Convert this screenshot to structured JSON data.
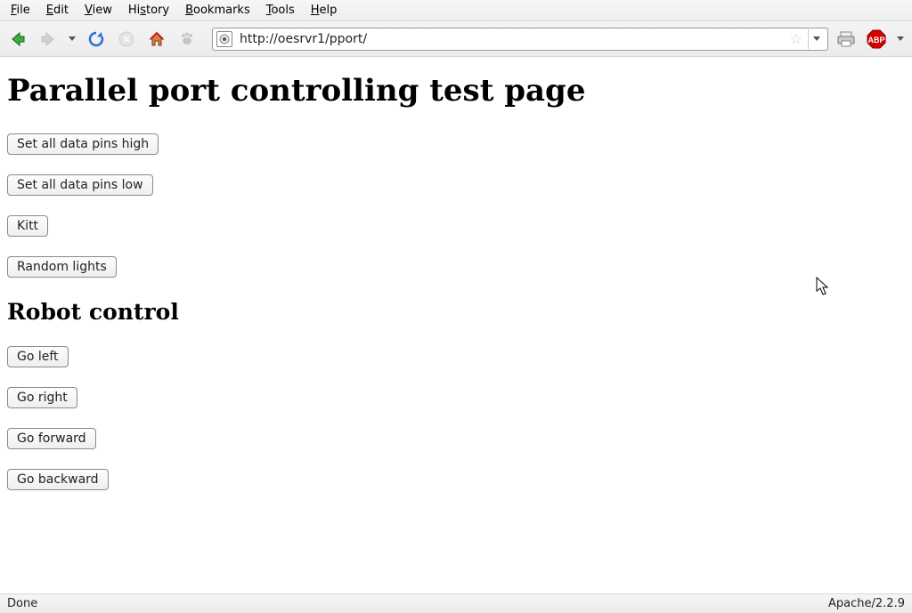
{
  "menubar": {
    "file": {
      "prefix": "F",
      "rest": "ile"
    },
    "edit": {
      "prefix": "E",
      "rest": "dit"
    },
    "view": {
      "prefix": "V",
      "rest": "iew"
    },
    "history": {
      "prefix": "Hi",
      "rest": "story"
    },
    "bookmarks": {
      "prefix": "B",
      "rest": "ookmarks"
    },
    "tools": {
      "prefix": "T",
      "rest": "ools"
    },
    "help": {
      "prefix": "H",
      "rest": "elp"
    }
  },
  "toolbar": {
    "url": "http://oesrvr1/pport/"
  },
  "page": {
    "h1": "Parallel port controlling test page",
    "buttons": {
      "set_high": "Set all data pins high",
      "set_low": "Set all data pins low",
      "kitt": "Kitt",
      "random": "Random lights"
    },
    "h2": "Robot control",
    "robot": {
      "left": "Go left",
      "right": "Go right",
      "forward": "Go forward",
      "backward": "Go backward"
    }
  },
  "statusbar": {
    "left": "Done",
    "right": "Apache/2.2.9"
  }
}
